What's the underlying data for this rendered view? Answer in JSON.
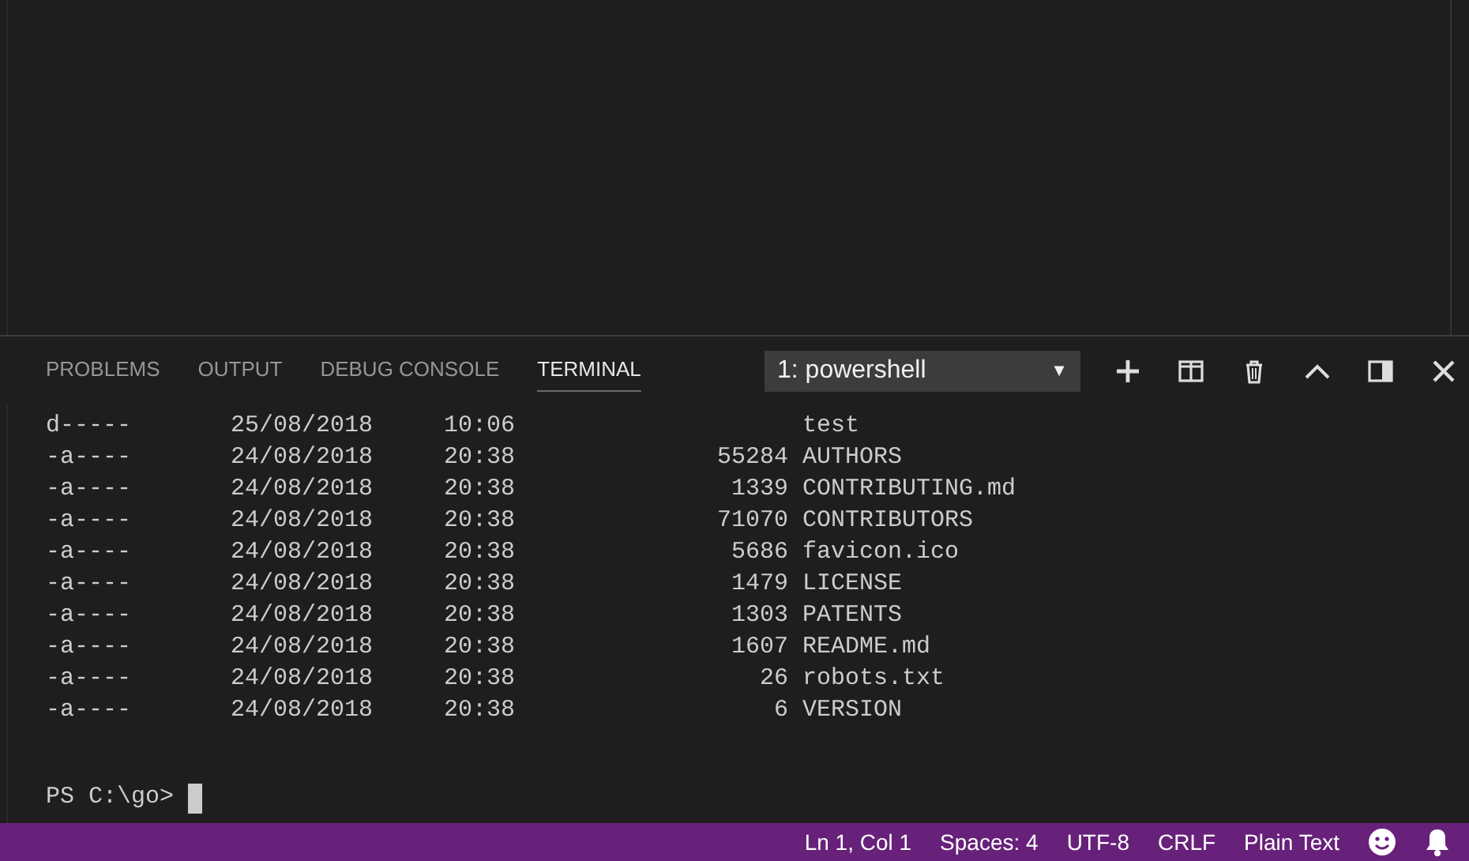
{
  "panel": {
    "tabs": [
      {
        "label": "PROBLEMS",
        "selected": false
      },
      {
        "label": "OUTPUT",
        "selected": false
      },
      {
        "label": "DEBUG CONSOLE",
        "selected": false
      },
      {
        "label": "TERMINAL",
        "selected": true
      }
    ],
    "terminal_select": {
      "value": "1: powershell",
      "caret": "▼"
    }
  },
  "terminal": {
    "rows": [
      {
        "mode": "d-----",
        "date": "25/08/2018",
        "time": "10:06",
        "length": "",
        "name": "test"
      },
      {
        "mode": "-a----",
        "date": "24/08/2018",
        "time": "20:38",
        "length": "55284",
        "name": "AUTHORS"
      },
      {
        "mode": "-a----",
        "date": "24/08/2018",
        "time": "20:38",
        "length": "1339",
        "name": "CONTRIBUTING.md"
      },
      {
        "mode": "-a----",
        "date": "24/08/2018",
        "time": "20:38",
        "length": "71070",
        "name": "CONTRIBUTORS"
      },
      {
        "mode": "-a----",
        "date": "24/08/2018",
        "time": "20:38",
        "length": "5686",
        "name": "favicon.ico"
      },
      {
        "mode": "-a----",
        "date": "24/08/2018",
        "time": "20:38",
        "length": "1479",
        "name": "LICENSE"
      },
      {
        "mode": "-a----",
        "date": "24/08/2018",
        "time": "20:38",
        "length": "1303",
        "name": "PATENTS"
      },
      {
        "mode": "-a----",
        "date": "24/08/2018",
        "time": "20:38",
        "length": "1607",
        "name": "README.md"
      },
      {
        "mode": "-a----",
        "date": "24/08/2018",
        "time": "20:38",
        "length": "26",
        "name": "robots.txt"
      },
      {
        "mode": "-a----",
        "date": "24/08/2018",
        "time": "20:38",
        "length": "6",
        "name": "VERSION"
      }
    ],
    "prompt": "PS C:\\go>"
  },
  "status_bar": {
    "items": [
      "Ln 1, Col 1",
      "Spaces: 4",
      "UTF-8",
      "CRLF",
      "Plain Text"
    ]
  }
}
